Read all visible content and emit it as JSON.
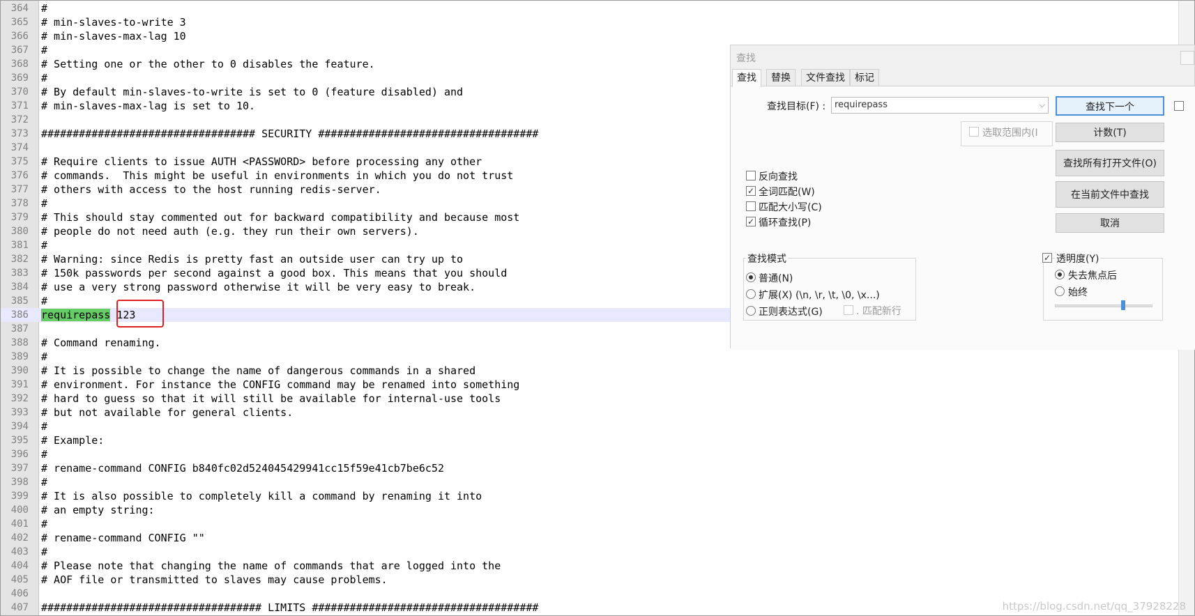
{
  "editor": {
    "current_line": "386",
    "lines": [
      {
        "n": "364",
        "text": "#"
      },
      {
        "n": "365",
        "text": "# min-slaves-to-write 3"
      },
      {
        "n": "366",
        "text": "# min-slaves-max-lag 10"
      },
      {
        "n": "367",
        "text": "#"
      },
      {
        "n": "368",
        "text": "# Setting one or the other to 0 disables the feature."
      },
      {
        "n": "369",
        "text": "#"
      },
      {
        "n": "370",
        "text": "# By default min-slaves-to-write is set to 0 (feature disabled) and"
      },
      {
        "n": "371",
        "text": "# min-slaves-max-lag is set to 10."
      },
      {
        "n": "372",
        "text": ""
      },
      {
        "n": "373",
        "text": "################################## SECURITY ###################################"
      },
      {
        "n": "374",
        "text": ""
      },
      {
        "n": "375",
        "text": "# Require clients to issue AUTH <PASSWORD> before processing any other"
      },
      {
        "n": "376",
        "text": "# commands.  This might be useful in environments in which you do not trust"
      },
      {
        "n": "377",
        "text": "# others with access to the host running redis-server."
      },
      {
        "n": "378",
        "text": "#"
      },
      {
        "n": "379",
        "text": "# This should stay commented out for backward compatibility and because most"
      },
      {
        "n": "380",
        "text": "# people do not need auth (e.g. they run their own servers)."
      },
      {
        "n": "381",
        "text": "#"
      },
      {
        "n": "382",
        "text": "# Warning: since Redis is pretty fast an outside user can try up to"
      },
      {
        "n": "383",
        "text": "# 150k passwords per second against a good box. This means that you should"
      },
      {
        "n": "384",
        "text": "# use a very strong password otherwise it will be very easy to break."
      },
      {
        "n": "385",
        "text": "#"
      },
      {
        "n": "386",
        "text": "",
        "match": "requirepass",
        "rest": " 123"
      },
      {
        "n": "387",
        "text": ""
      },
      {
        "n": "388",
        "text": "# Command renaming."
      },
      {
        "n": "389",
        "text": "#"
      },
      {
        "n": "390",
        "text": "# It is possible to change the name of dangerous commands in a shared"
      },
      {
        "n": "391",
        "text": "# environment. For instance the CONFIG command may be renamed into something"
      },
      {
        "n": "392",
        "text": "# hard to guess so that it will still be available for internal-use tools"
      },
      {
        "n": "393",
        "text": "# but not available for general clients."
      },
      {
        "n": "394",
        "text": "#"
      },
      {
        "n": "395",
        "text": "# Example:"
      },
      {
        "n": "396",
        "text": "#"
      },
      {
        "n": "397",
        "text": "# rename-command CONFIG b840fc02d524045429941cc15f59e41cb7be6c52"
      },
      {
        "n": "398",
        "text": "#"
      },
      {
        "n": "399",
        "text": "# It is also possible to completely kill a command by renaming it into"
      },
      {
        "n": "400",
        "text": "# an empty string:"
      },
      {
        "n": "401",
        "text": "#"
      },
      {
        "n": "402",
        "text": "# rename-command CONFIG \"\""
      },
      {
        "n": "403",
        "text": "#"
      },
      {
        "n": "404",
        "text": "# Please note that changing the name of commands that are logged into the"
      },
      {
        "n": "405",
        "text": "# AOF file or transmitted to slaves may cause problems."
      },
      {
        "n": "406",
        "text": ""
      },
      {
        "n": "407",
        "text": "################################### LIMITS ####################################"
      }
    ]
  },
  "find_dialog": {
    "title": "查找",
    "tabs": [
      "查找",
      "替换",
      "文件查找",
      "标记"
    ],
    "active_tab": 0,
    "target_label": "查找目标(F) :",
    "target_value": "requirepass",
    "in_selection_label": "选取范围内(I",
    "buttons": {
      "find_next": "查找下一个",
      "count": "计数(T)",
      "find_all_open": "查找所有打开文件(O)",
      "find_in_current": "在当前文件中查找",
      "cancel": "取消"
    },
    "options": [
      {
        "label": "反向查找",
        "checked": false
      },
      {
        "label": "全词匹配(W)",
        "checked": true
      },
      {
        "label": "匹配大小写(C)",
        "checked": false
      },
      {
        "label": "循环查找(P)",
        "checked": true
      }
    ],
    "search_mode": {
      "title": "查找模式",
      "normal": "普通(N)",
      "extended": "扩展(X) (\\n, \\r, \\t, \\0, \\x...)",
      "regex": "正则表达式(G)",
      "dot_newline": ". 匹配新行",
      "selected": "normal"
    },
    "transparency": {
      "label": "透明度(Y)",
      "checked": true,
      "on_lose_focus": "失去焦点后",
      "always": "始终",
      "selected": "on_lose_focus",
      "level": 0.7
    }
  },
  "watermark": "https://blog.csdn.net/qq_37928228",
  "colors": {
    "match_highlight": "#66cc66",
    "current_line": "#e8e8ff",
    "annotation_box": "#e02020"
  }
}
